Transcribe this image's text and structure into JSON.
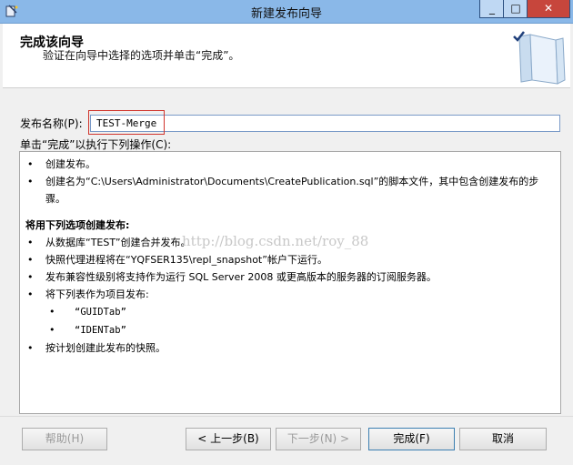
{
  "window": {
    "title": "新建发布向导",
    "minimize_glyph": "_",
    "maximize_glyph": "□",
    "close_glyph": "✕",
    "app_icon": "wizard-icon"
  },
  "header": {
    "title": "完成该向导",
    "subtitle": "验证在向导中选择的选项并单击“完成”。",
    "icon": "book-icon"
  },
  "publication": {
    "name_label": "发布名称(P):",
    "name_value": "TEST-Merge"
  },
  "actions": {
    "label": "单击“完成”以执行下列操作(C):",
    "items": [
      {
        "bullet": "•",
        "text": "创建发布。"
      },
      {
        "bullet": "•",
        "text": "创建名为“C:\\Users\\Administrator\\Documents\\CreatePublication.sql”的脚本文件，其中包含创建发布的步骤。"
      }
    ],
    "heading": "将用下列选项创建发布:",
    "options": [
      {
        "bullet": "•",
        "text": "从数据库“TEST”创建合并发布。"
      },
      {
        "bullet": "•",
        "text": "快照代理进程将在“YQFSER135\\repl_snapshot”帐户下运行。"
      },
      {
        "bullet": "•",
        "text": "发布兼容性级别将支持作为运行 SQL Server 2008 或更高版本的服务器的订阅服务器。"
      },
      {
        "bullet": "•",
        "text": "将下列表作为项目发布:"
      }
    ],
    "tables": [
      {
        "bullet": "•",
        "text": "“GUIDTab”"
      },
      {
        "bullet": "•",
        "text": "“IDENTab”"
      }
    ],
    "last": {
      "bullet": "•",
      "text": "按计划创建此发布的快照。"
    }
  },
  "watermark": "http://blog.csdn.net/roy_88",
  "buttons": {
    "help": "帮助(H)",
    "back": "< 上一步(B)",
    "next": "下一步(N) >",
    "finish": "完成(F)",
    "cancel": "取消"
  },
  "colors": {
    "titlebar": "#8ab8e8",
    "close_button": "#c7463c",
    "highlight_box": "#d0342c"
  }
}
